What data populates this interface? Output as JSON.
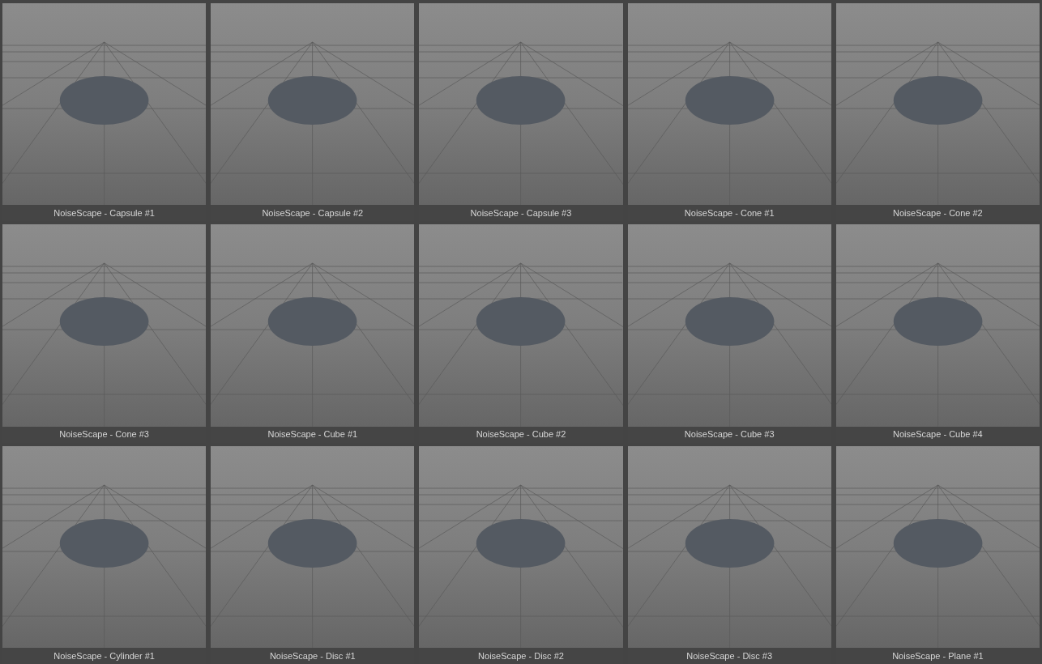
{
  "items": [
    {
      "label": "NoiseScape - Capsule #1"
    },
    {
      "label": "NoiseScape - Capsule #2"
    },
    {
      "label": "NoiseScape - Capsule #3"
    },
    {
      "label": "NoiseScape - Cone #1"
    },
    {
      "label": "NoiseScape - Cone #2"
    },
    {
      "label": "NoiseScape - Cone #3"
    },
    {
      "label": "NoiseScape - Cube #1"
    },
    {
      "label": "NoiseScape - Cube #2"
    },
    {
      "label": "NoiseScape - Cube #3"
    },
    {
      "label": "NoiseScape - Cube #4"
    },
    {
      "label": "NoiseScape - Cylinder #1"
    },
    {
      "label": "NoiseScape - Disc #1"
    },
    {
      "label": "NoiseScape - Disc #2"
    },
    {
      "label": "NoiseScape - Disc #3"
    },
    {
      "label": "NoiseScape - Plane #1"
    }
  ]
}
